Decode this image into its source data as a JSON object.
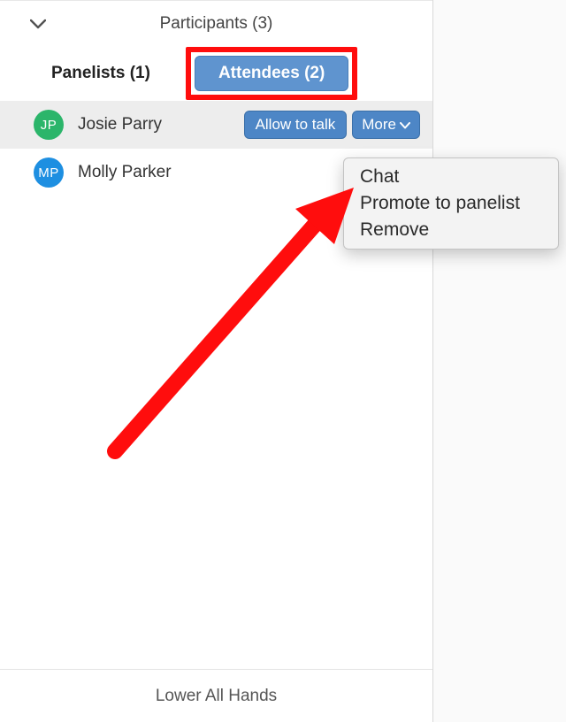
{
  "header": {
    "title": "Participants (3)"
  },
  "tabs": {
    "panelists": "Panelists (1)",
    "attendees": "Attendees (2)"
  },
  "attendees": [
    {
      "initials": "JP",
      "name": "Josie Parry",
      "avatarColor": "green",
      "hovered": true
    },
    {
      "initials": "MP",
      "name": "Molly Parker",
      "avatarColor": "blue",
      "hovered": false
    }
  ],
  "rowActions": {
    "allow": "Allow to talk",
    "more": "More"
  },
  "moreMenu": {
    "chat": "Chat",
    "promote": "Promote to panelist",
    "remove": "Remove"
  },
  "footer": {
    "lowerHands": "Lower All Hands"
  }
}
